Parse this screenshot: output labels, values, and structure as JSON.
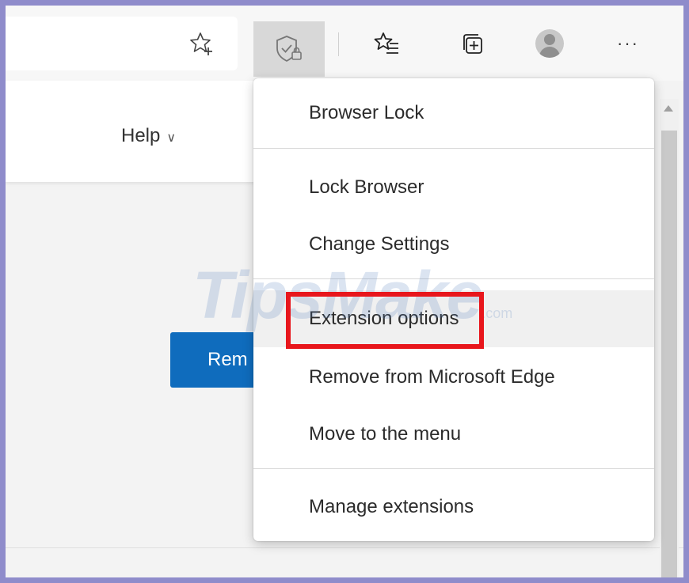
{
  "toolbar": {
    "icons": [
      "star-add-icon",
      "extension-shield-icon",
      "favorites-icon",
      "collections-icon",
      "profile-avatar",
      "more-icon"
    ],
    "more_label": "···"
  },
  "page": {
    "help_label": "Help",
    "help_chevron": "∨",
    "remove_button_partial": "Rem"
  },
  "menu": {
    "title": "Browser Lock",
    "items": [
      "Lock Browser",
      "Change Settings",
      "Extension options",
      "Remove from Microsoft Edge",
      "Move to the menu",
      "Manage extensions"
    ]
  },
  "watermark": {
    "text": "TipsMake",
    "suffix": ".com"
  },
  "colors": {
    "frame": "#8f8ccb",
    "highlight": "#e8161c",
    "accent_blue": "#0f6cbd"
  }
}
